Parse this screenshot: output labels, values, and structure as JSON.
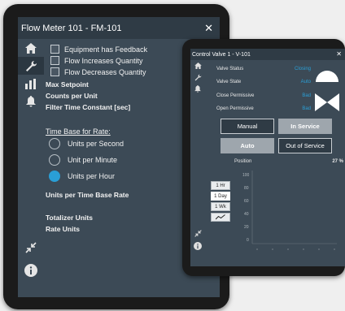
{
  "flow_meter": {
    "title": "Flow Meter 101 - FM-101",
    "close_glyph": "✕",
    "checkboxes": [
      {
        "label": "Equipment has Feedback",
        "checked": false
      },
      {
        "label": "Flow Increases Quantity",
        "checked": false
      },
      {
        "label": "Flow Decreases Quantity",
        "checked": false
      }
    ],
    "fields": [
      "Max Setpoint",
      "Counts per Unit",
      "Filter Time Constant [sec]"
    ],
    "time_base_heading": "Time Base for Rate:",
    "radios": [
      {
        "label": "Units per Second",
        "selected": false
      },
      {
        "label": "Unit per Minute",
        "selected": false
      },
      {
        "label": "Units per Hour",
        "selected": true
      }
    ],
    "units_per_time_label": "Units per Time Base Rate",
    "totalizer_label": "Totalizer Units",
    "rate_units_label": "Rate Units",
    "sidebar_icons": [
      "home-icon",
      "wrench-icon",
      "bar-chart-icon",
      "bell-icon"
    ],
    "sidebar_bottom_icons": [
      "collapse-icon",
      "info-icon"
    ]
  },
  "control_valve": {
    "title": "Control Valve 1 - V-101",
    "close_glyph": "✕",
    "status_rows": [
      {
        "label": "Valve Status",
        "value": "Closing"
      },
      {
        "label": "Valve State",
        "value": "Auto"
      },
      {
        "label": "Close Permissive",
        "value": "Bad"
      },
      {
        "label": "Open Permissive",
        "value": "Bad"
      }
    ],
    "buttons": {
      "manual": "Manual",
      "in_service": "In Service",
      "auto": "Auto",
      "out_of_service": "Out of Service"
    },
    "position_label": "Position",
    "position_value": "27 %",
    "ranges": [
      "1 Hr",
      "1 Day",
      "1 Wk"
    ],
    "selected_range": "1 Day",
    "trend_icon": "trend-icon",
    "chart": {
      "y_ticks": [
        "100",
        "80",
        "60",
        "40",
        "20",
        "0"
      ]
    },
    "colors": {
      "accent": "#2a9fd6",
      "panel": "#3c4a56"
    }
  }
}
